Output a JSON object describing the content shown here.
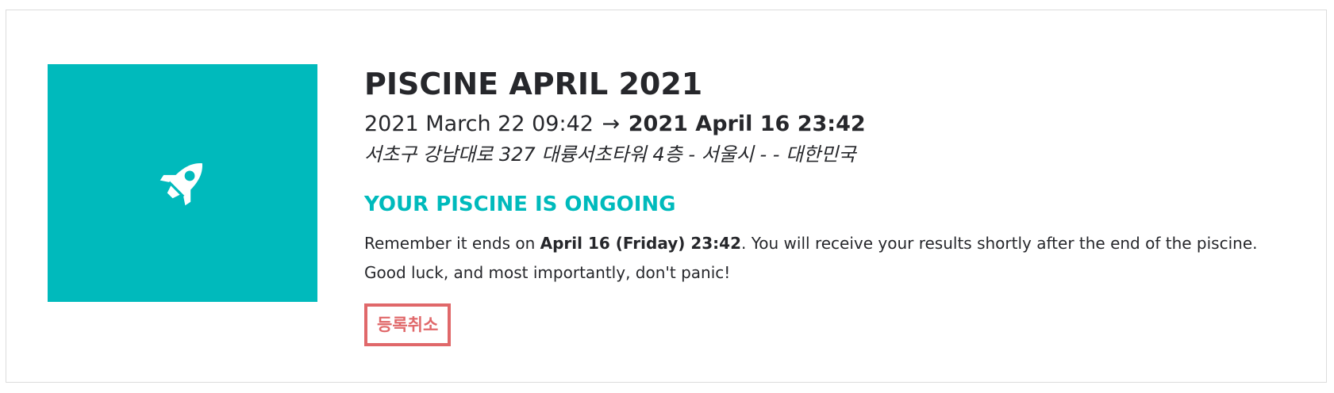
{
  "piscine": {
    "title": "PISCINE APRIL 2021",
    "start_date": "2021 March 22 09:42",
    "arrow": "→",
    "end_date": "2021 April 16 23:42",
    "address": "서초구 강남대로 327 대륭서초타워 4층 - 서울시 - - 대한민국",
    "status": "YOUR PISCINE IS ONGOING",
    "message_prefix": "Remember it ends on ",
    "message_end_date": "April 16 (Friday) 23:42",
    "message_suffix": ". You will receive your results shortly after the end of the piscine. Good luck, and most importantly, don't panic!",
    "cancel_label": "등록취소"
  },
  "colors": {
    "accent": "#00babc",
    "cancel": "#e0686a",
    "text": "#26272b"
  },
  "icon": "rocket-icon"
}
